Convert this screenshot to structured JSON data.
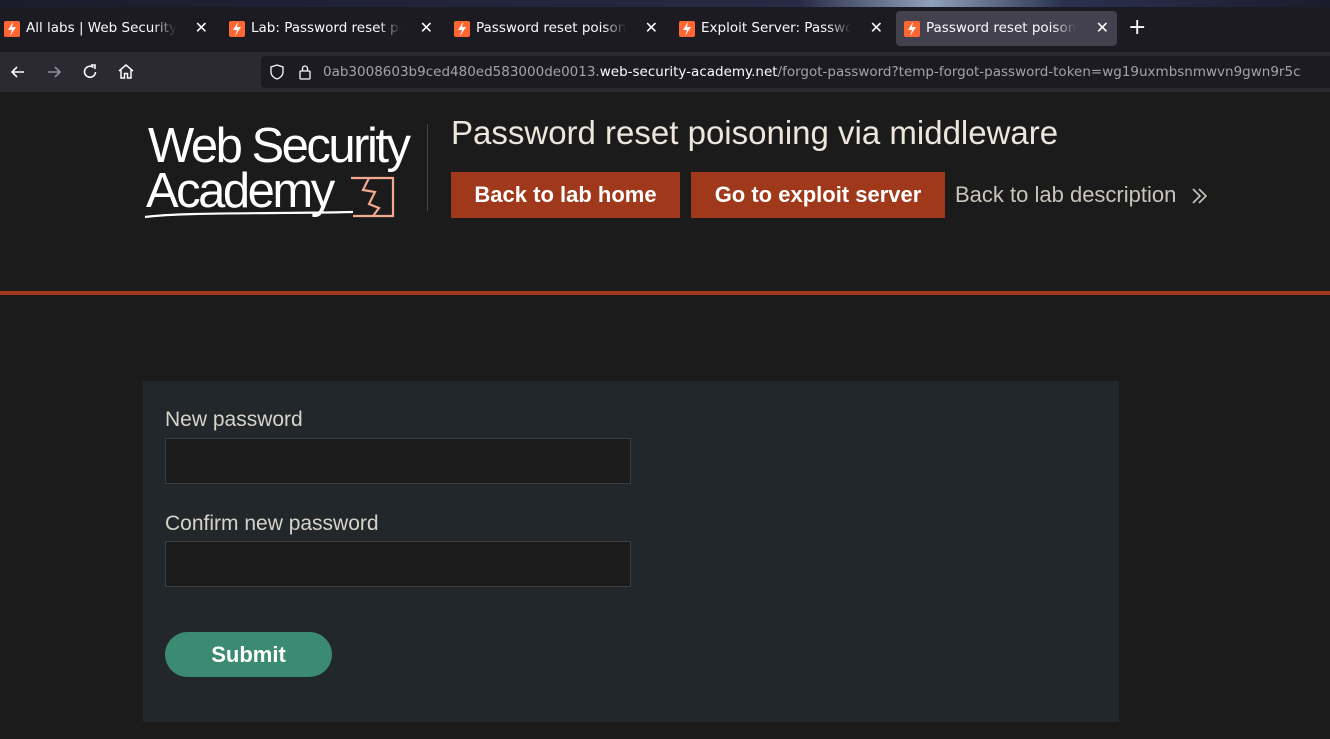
{
  "browser": {
    "tabs": [
      {
        "title": "All labs | Web Security Academy",
        "active": false
      },
      {
        "title": "Lab: Password reset poisoning via middleware",
        "active": false
      },
      {
        "title": "Password reset poisoning via middleware",
        "active": false
      },
      {
        "title": "Exploit Server: Password reset poisoning via middleware",
        "active": false
      },
      {
        "title": "Password reset poisoning via middleware",
        "active": true
      }
    ],
    "close_glyph": "✕",
    "new_tab_glyph": "+",
    "url_prefix": "0ab3008603b9ced480ed583000de0013.",
    "url_host": "web-security-academy.net",
    "url_path": "/forgot-password?temp-forgot-password-token=wg19uxmbsnmwvn9gwn9r5c"
  },
  "header": {
    "logo_line1": "Web Security",
    "logo_line2": "Academy",
    "lab_title": "Password reset poisoning via middleware",
    "back_to_lab_home": "Back to lab home",
    "go_to_exploit_server": "Go to exploit server",
    "back_to_lab_description": "Back to lab description"
  },
  "form": {
    "new_password_label": "New password",
    "new_password_value": "",
    "confirm_password_label": "Confirm new password",
    "confirm_password_value": "",
    "submit_label": "Submit"
  },
  "colors": {
    "accent_orange": "#a0391b",
    "submit_green": "#3b8a72",
    "panel_bg": "#21272a",
    "page_bg": "#1b1b1b"
  }
}
